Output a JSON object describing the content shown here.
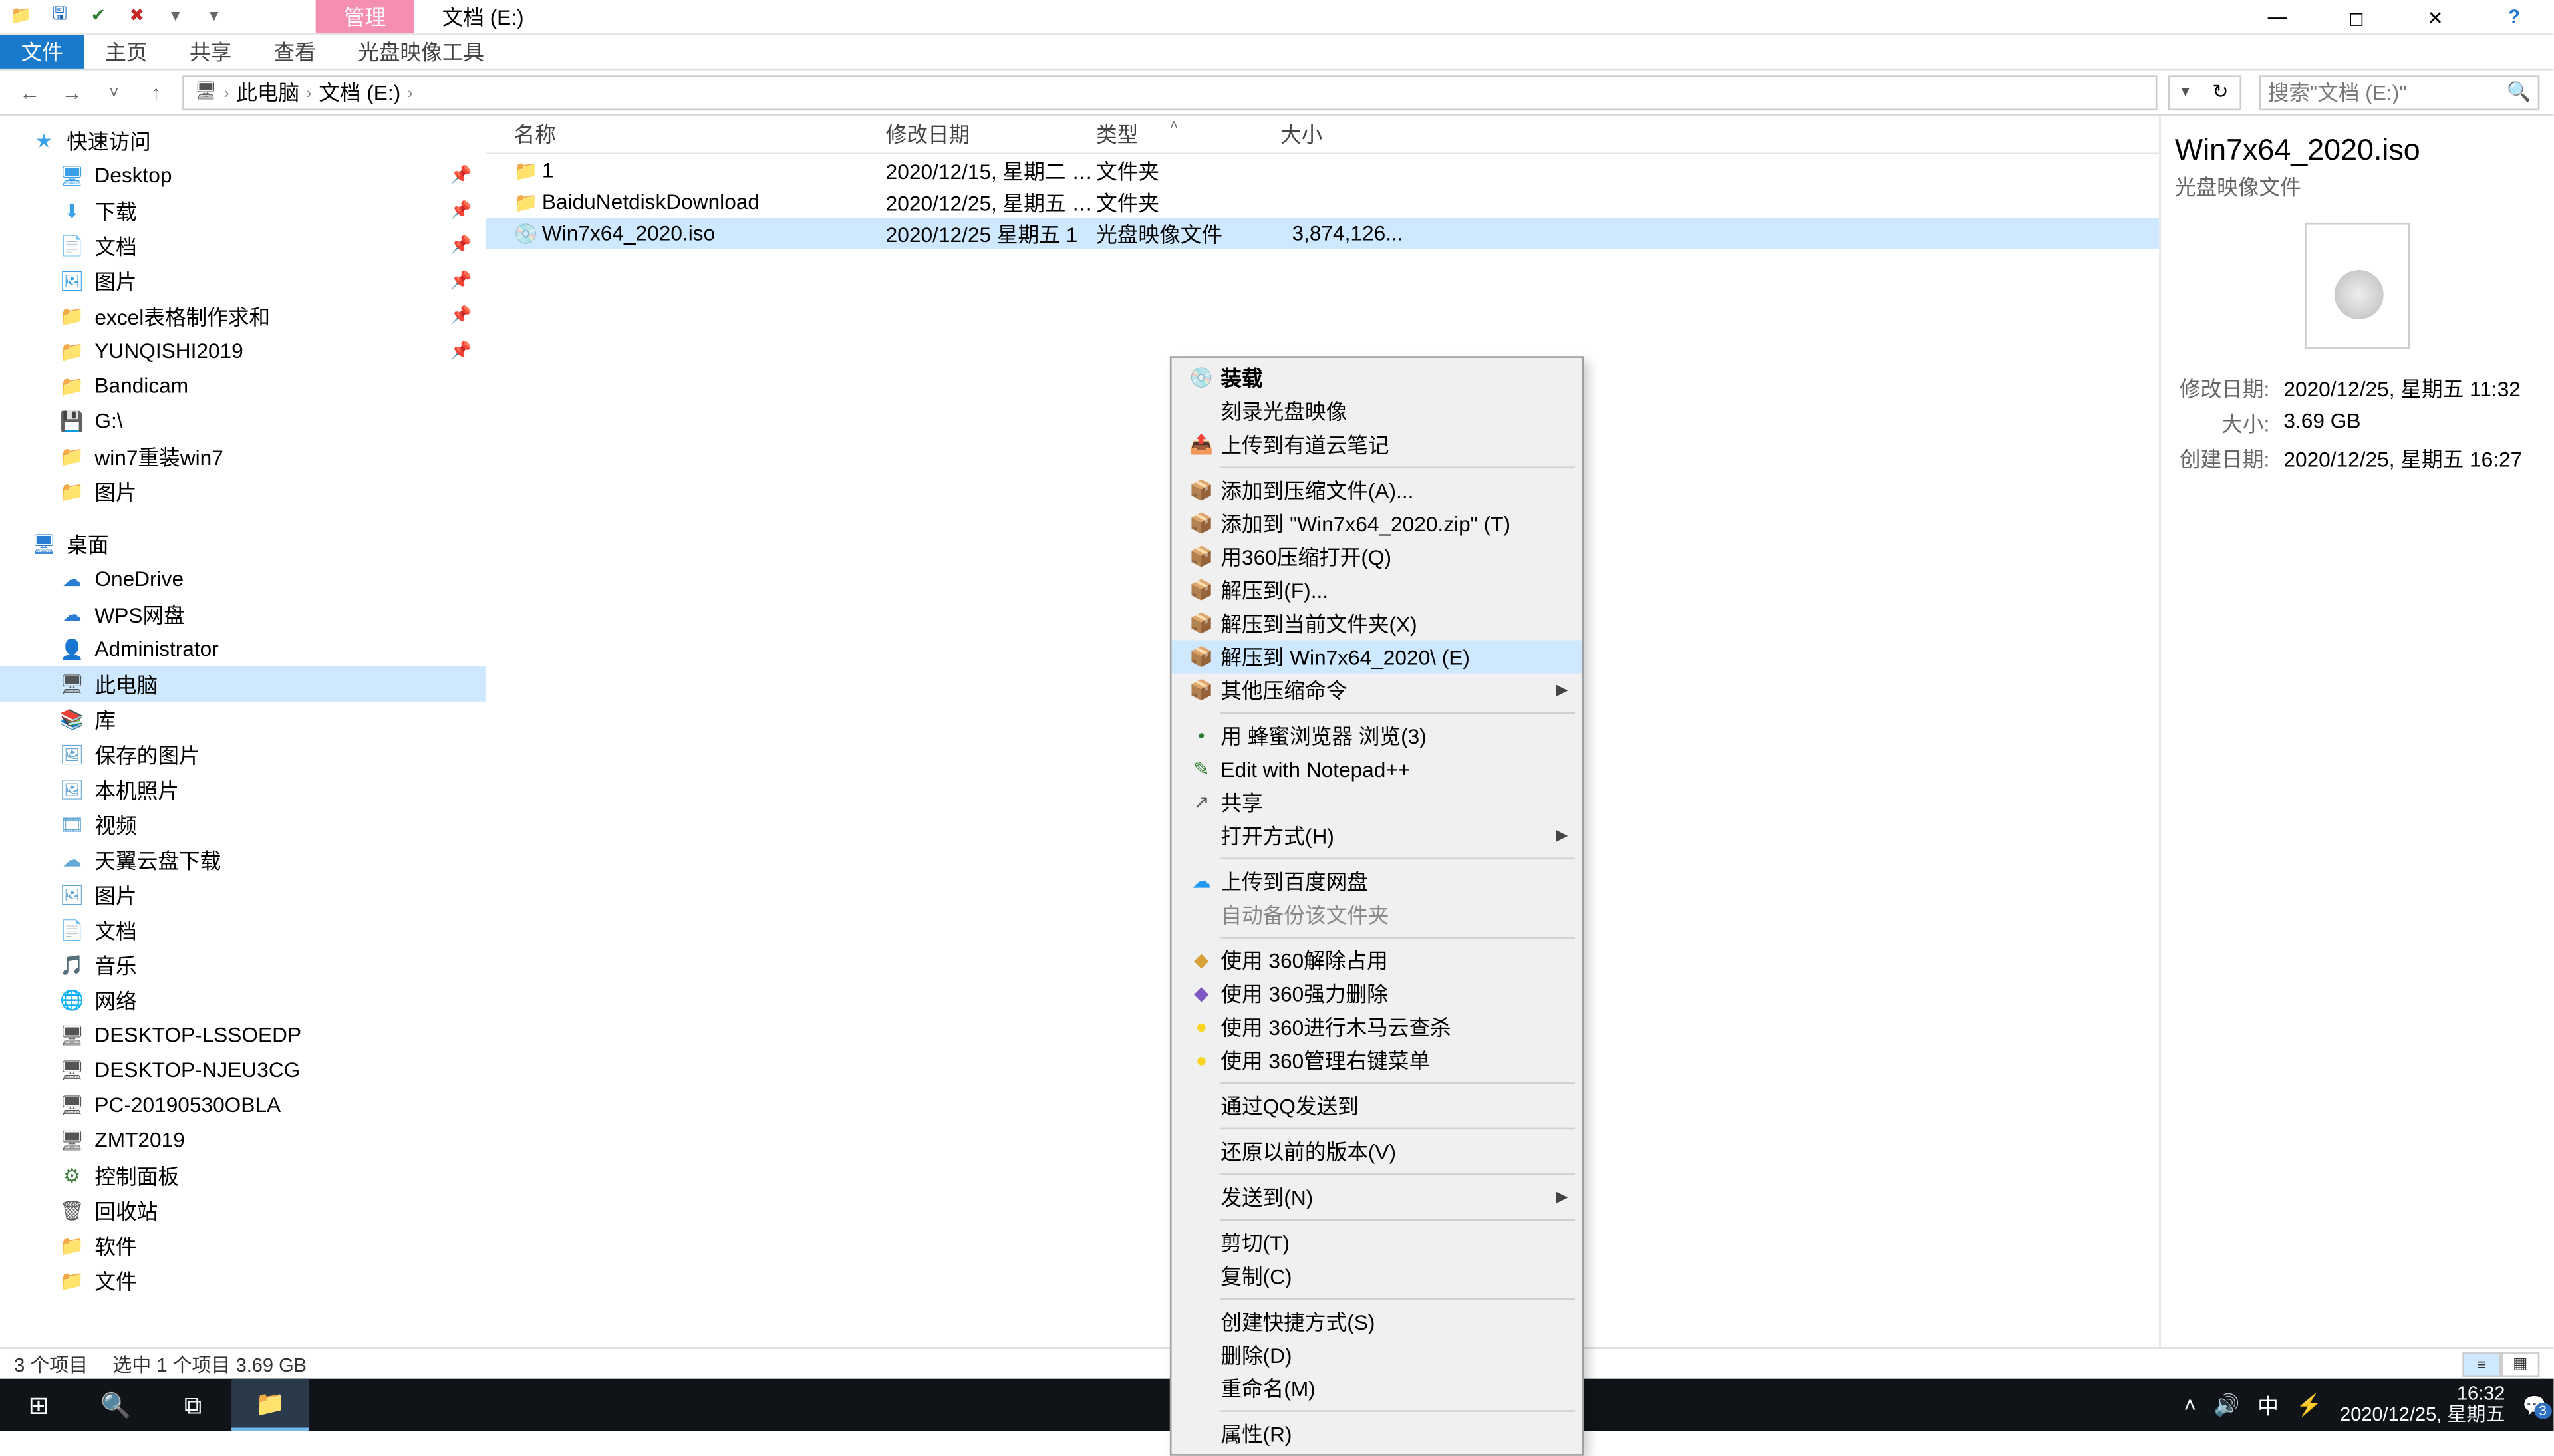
{
  "quickaccess": {
    "save": "🖫",
    "redo": "✔",
    "delete": "✖",
    "dd": "▾",
    "more": "▾"
  },
  "title_tabs": {
    "a": "管理",
    "b": "文档 (E:)"
  },
  "windowctl": {
    "help": "?"
  },
  "ribbon": {
    "file": "文件",
    "tabs": [
      "主页",
      "共享",
      "查看",
      "光盘映像工具"
    ]
  },
  "nav": {
    "back": "←",
    "fwd": "→",
    "up": "↑",
    "dd": "▾",
    "refresh": "↻",
    "crumbs": [
      "此电脑",
      "文档 (E:)"
    ],
    "search_placeholder": "搜索\"文档 (E:)\""
  },
  "tree": {
    "quick": {
      "label": "快速访问",
      "star": "★",
      "items": [
        {
          "ico": "🖥",
          "label": "Desktop",
          "pin": true,
          "color": "#3aa0e8"
        },
        {
          "ico": "⬇",
          "label": "下载",
          "pin": true,
          "color": "#3aa0e8"
        },
        {
          "ico": "📄",
          "label": "文档",
          "pin": true,
          "color": "#3aa0e8"
        },
        {
          "ico": "🖼",
          "label": "图片",
          "pin": true,
          "color": "#3aa0e8"
        },
        {
          "ico": "📁",
          "label": "excel表格制作求和",
          "pin": true,
          "color": "#f5c853"
        },
        {
          "ico": "📁",
          "label": "YUNQISHI2019",
          "pin": true,
          "color": "#f5c853"
        },
        {
          "ico": "📁",
          "label": "Bandicam",
          "color": "#f5c853"
        },
        {
          "ico": "💾",
          "label": "G:\\",
          "color": "#888"
        },
        {
          "ico": "📁",
          "label": "win7重装win7",
          "color": "#f5c853"
        },
        {
          "ico": "📁",
          "label": "图片",
          "color": "#f5c853"
        }
      ]
    },
    "desktop": {
      "label": "桌面",
      "ico": "🖥",
      "color": "#2b7cd3",
      "items": [
        {
          "ico": "☁",
          "label": "OneDrive",
          "color": "#2b7cd3"
        },
        {
          "ico": "☁",
          "label": "WPS网盘",
          "color": "#2b7cd3"
        },
        {
          "ico": "👤",
          "label": "Administrator",
          "color": "#6fa46f"
        },
        {
          "ico": "🖥",
          "label": "此电脑",
          "selected": true,
          "color": "#555"
        },
        {
          "ico": "📚",
          "label": "库",
          "color": "#62a7d6"
        },
        {
          "ico": "🖼",
          "label": "保存的图片",
          "lvl": 2,
          "color": "#62a7d6"
        },
        {
          "ico": "🖼",
          "label": "本机照片",
          "lvl": 2,
          "color": "#62a7d6"
        },
        {
          "ico": "🎞",
          "label": "视频",
          "lvl": 2,
          "color": "#62a7d6"
        },
        {
          "ico": "☁",
          "label": "天翼云盘下载",
          "lvl": 2,
          "color": "#62a7d6"
        },
        {
          "ico": "🖼",
          "label": "图片",
          "lvl": 2,
          "color": "#62a7d6"
        },
        {
          "ico": "📄",
          "label": "文档",
          "lvl": 2,
          "color": "#62a7d6"
        },
        {
          "ico": "🎵",
          "label": "音乐",
          "lvl": 2,
          "color": "#62a7d6"
        },
        {
          "ico": "🌐",
          "label": "网络",
          "color": "#3a7d3a"
        },
        {
          "ico": "🖥",
          "label": "DESKTOP-LSSOEDP",
          "lvl": 2,
          "color": "#555"
        },
        {
          "ico": "🖥",
          "label": "DESKTOP-NJEU3CG",
          "lvl": 2,
          "color": "#555"
        },
        {
          "ico": "🖥",
          "label": "PC-20190530OBLA",
          "lvl": 2,
          "color": "#555"
        },
        {
          "ico": "🖥",
          "label": "ZMT2019",
          "lvl": 2,
          "color": "#555"
        },
        {
          "ico": "⚙",
          "label": "控制面板",
          "color": "#3a7d3a"
        },
        {
          "ico": "🗑",
          "label": "回收站",
          "color": "#555"
        },
        {
          "ico": "📁",
          "label": "软件",
          "color": "#f5c853"
        },
        {
          "ico": "📁",
          "label": "文件",
          "color": "#f5c853"
        }
      ]
    }
  },
  "columns": {
    "name": "名称",
    "date": "修改日期",
    "type": "类型",
    "size": "大小"
  },
  "files": [
    {
      "ico": "📁",
      "ico_color": "#f5c853",
      "name": "1",
      "date": "2020/12/15, 星期二 1...",
      "type": "文件夹",
      "size": ""
    },
    {
      "ico": "📁",
      "ico_color": "#f5c853",
      "name": "BaiduNetdiskDownload",
      "date": "2020/12/25, 星期五 1...",
      "type": "文件夹",
      "size": ""
    },
    {
      "ico": "💿",
      "ico_color": "#888",
      "name": "Win7x64_2020.iso",
      "date": "2020/12/25  星期五 1",
      "type": "光盘映像文件",
      "size": "3,874,126...",
      "selected": true
    }
  ],
  "details": {
    "title": "Win7x64_2020.iso",
    "subtitle": "光盘映像文件",
    "rows": [
      {
        "k": "修改日期:",
        "v": "2020/12/25, 星期五 11:32"
      },
      {
        "k": "大小:",
        "v": "3.69 GB"
      },
      {
        "k": "创建日期:",
        "v": "2020/12/25, 星期五 16:27"
      }
    ]
  },
  "context_menu": [
    {
      "t": "装载",
      "bold": true,
      "ico": "💿"
    },
    {
      "t": "刻录光盘映像"
    },
    {
      "t": "上传到有道云笔记",
      "ico": "📤",
      "ico_color": "#2196f3"
    },
    {
      "sep": true
    },
    {
      "t": "添加到压缩文件(A)...",
      "ico": "📦",
      "ico_color": "#d6a23a"
    },
    {
      "t": "添加到 \"Win7x64_2020.zip\" (T)",
      "ico": "📦",
      "ico_color": "#d6a23a"
    },
    {
      "t": "用360压缩打开(Q)",
      "ico": "📦",
      "ico_color": "#d6a23a"
    },
    {
      "t": "解压到(F)...",
      "ico": "📦",
      "ico_color": "#d6a23a"
    },
    {
      "t": "解压到当前文件夹(X)",
      "ico": "📦",
      "ico_color": "#d6a23a"
    },
    {
      "t": "解压到 Win7x64_2020\\ (E)",
      "ico": "📦",
      "ico_color": "#d6a23a",
      "hover": true
    },
    {
      "t": "其他压缩命令",
      "ico": "📦",
      "ico_color": "#d6a23a",
      "sub": true
    },
    {
      "sep": true
    },
    {
      "t": "用 蜂蜜浏览器 浏览(3)",
      "ico": "•",
      "ico_color": "#2e7d32"
    },
    {
      "t": "Edit with Notepad++",
      "ico": "✎",
      "ico_color": "#2e7d32"
    },
    {
      "t": "共享",
      "ico": "↗"
    },
    {
      "t": "打开方式(H)",
      "sub": true
    },
    {
      "sep": true
    },
    {
      "t": "上传到百度网盘",
      "ico": "☁",
      "ico_color": "#2196f3"
    },
    {
      "t": "自动备份该文件夹",
      "disabled": true
    },
    {
      "sep": true
    },
    {
      "t": "使用 360解除占用",
      "ico": "◆",
      "ico_color": "#d6a23a"
    },
    {
      "t": "使用 360强力删除",
      "ico": "◆",
      "ico_color": "#7e57c2"
    },
    {
      "t": "使用 360进行木马云查杀",
      "ico": "●",
      "ico_color": "#f9d423"
    },
    {
      "t": "使用 360管理右键菜单",
      "ico": "●",
      "ico_color": "#f9d423"
    },
    {
      "sep": true
    },
    {
      "t": "通过QQ发送到"
    },
    {
      "sep": true
    },
    {
      "t": "还原以前的版本(V)"
    },
    {
      "sep": true
    },
    {
      "t": "发送到(N)",
      "sub": true
    },
    {
      "sep": true
    },
    {
      "t": "剪切(T)"
    },
    {
      "t": "复制(C)"
    },
    {
      "sep": true
    },
    {
      "t": "创建快捷方式(S)"
    },
    {
      "t": "删除(D)"
    },
    {
      "t": "重命名(M)"
    },
    {
      "sep": true
    },
    {
      "t": "属性(R)"
    }
  ],
  "status": {
    "count": "3 个项目",
    "sel": "选中 1 个项目  3.69 GB"
  },
  "taskbar": {
    "left": [
      {
        "ico": "⊞",
        "name": "start"
      },
      {
        "ico": "🔍",
        "name": "search"
      },
      {
        "ico": "⧉",
        "name": "taskview"
      },
      {
        "ico": "📁",
        "name": "explorer",
        "active": true
      }
    ],
    "tray": [
      "˄",
      "🔊",
      "中",
      "⚡"
    ],
    "time": "16:32",
    "date": "2020/12/25, 星期五",
    "badge": "3"
  }
}
